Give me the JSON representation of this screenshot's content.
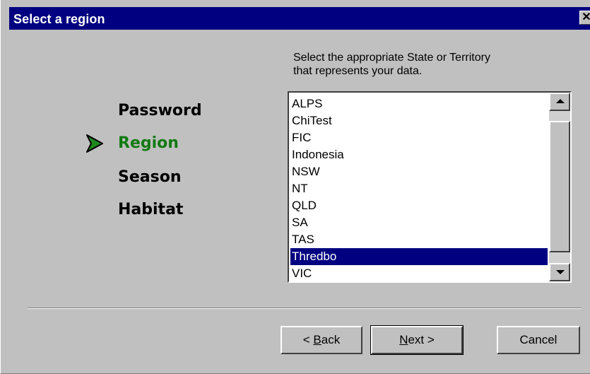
{
  "window": {
    "title": "Select a region",
    "close_glyph": "✕"
  },
  "steps": [
    {
      "label": "Password",
      "active": false
    },
    {
      "label": "Region",
      "active": true
    },
    {
      "label": "Season",
      "active": false
    },
    {
      "label": "Habitat",
      "active": false
    }
  ],
  "current_step_icon": "green-arrow-icon",
  "instructions": {
    "line1": "Select the appropriate State or Territory",
    "line2": "that represents your data."
  },
  "region_list": {
    "items": [
      "ALPS",
      "ChiTest",
      "FIC",
      "Indonesia",
      "NSW",
      "NT",
      "QLD",
      "SA",
      "TAS",
      "Thredbo",
      "VIC"
    ],
    "selected": "Thredbo"
  },
  "buttons": {
    "back_prefix": "< ",
    "back_mnemonic": "B",
    "back_rest": "ack",
    "next_mnemonic": "N",
    "next_rest": "ext >",
    "cancel": "Cancel"
  },
  "colors": {
    "titlebar": "#000080",
    "selection": "#000080",
    "active_step": "#127a12",
    "face": "#c0c0c0"
  }
}
